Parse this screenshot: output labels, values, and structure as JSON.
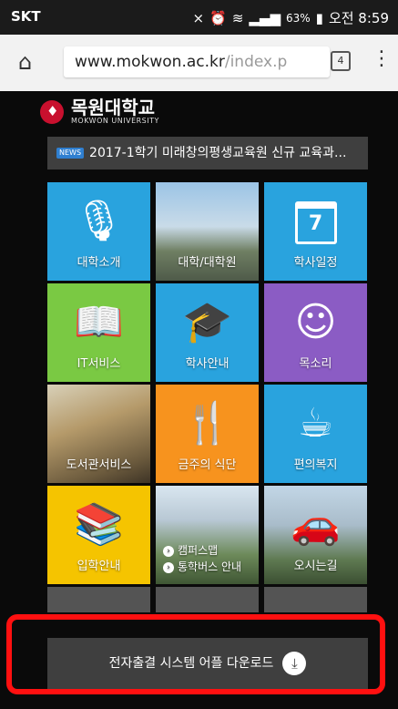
{
  "statusbar": {
    "carrier": "SKT",
    "battery": "63%",
    "time": "오전 8:59"
  },
  "browser": {
    "url_main": "www.mokwon.ac.kr",
    "url_rest": "/index.p",
    "tab_count": "4"
  },
  "site": {
    "logo_name": "목원대학교",
    "logo_sub": "MOKWON UNIVERSITY",
    "news_badge": "NEWS",
    "news_text": "2017-1학기 미래창의평생교육원 신규 교육과..."
  },
  "tiles": {
    "t1": "대학소개",
    "t2": "대학/대학원",
    "t3": "학사일정",
    "t3_day": "7",
    "t4": "IT서비스",
    "t5": "학사안내",
    "t6": "목소리",
    "t7": "도서관서비스",
    "t8": "금주의 식단",
    "t9": "편의복지",
    "t10": "입학안내",
    "t11a": "캠퍼스맵",
    "t11b": "통학버스 안내",
    "t12": "오시는길"
  },
  "download": {
    "label": "전자출결 시스템 어플 다운로드"
  },
  "colors": {
    "blue": "#29a3de",
    "green": "#7ac943",
    "purple": "#8b5cc4",
    "orange": "#f7931e",
    "yellow": "#f5c400",
    "highlight": "#ff1010"
  }
}
